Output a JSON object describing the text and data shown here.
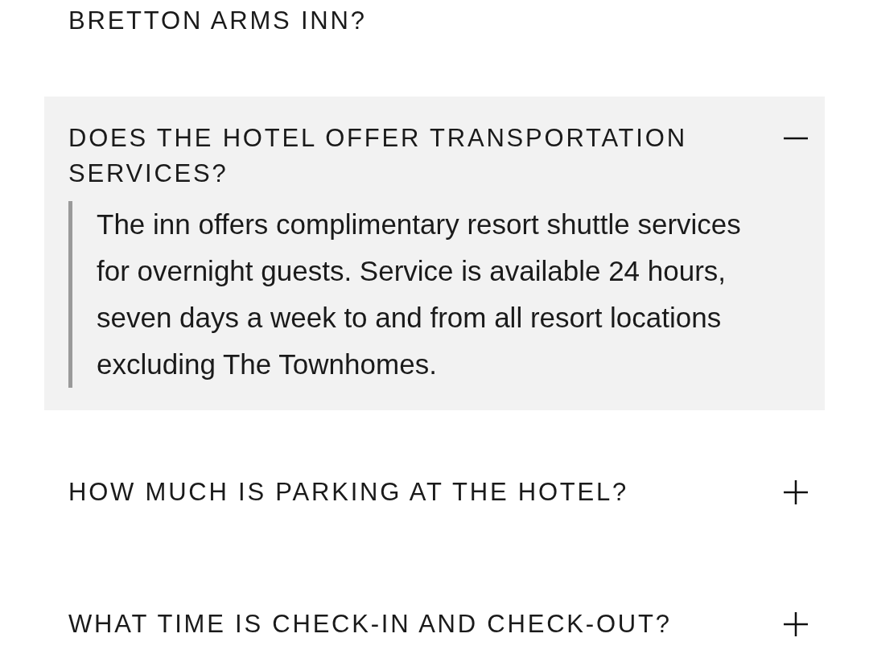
{
  "cut_heading": "BRETTON ARMS INN?",
  "faq": [
    {
      "question": "DOES THE HOTEL OFFER TRANSPORTATION SERVICES?",
      "expanded": true,
      "answer": "The inn offers complimentary resort shuttle services for overnight guests. Service is available 24 hours, seven days a week to and from all resort locations excluding The Townhomes."
    },
    {
      "question": "HOW MUCH IS PARKING AT THE HOTEL?",
      "expanded": false
    },
    {
      "question": "WHAT TIME IS CHECK-IN AND CHECK-OUT?",
      "expanded": false
    }
  ]
}
